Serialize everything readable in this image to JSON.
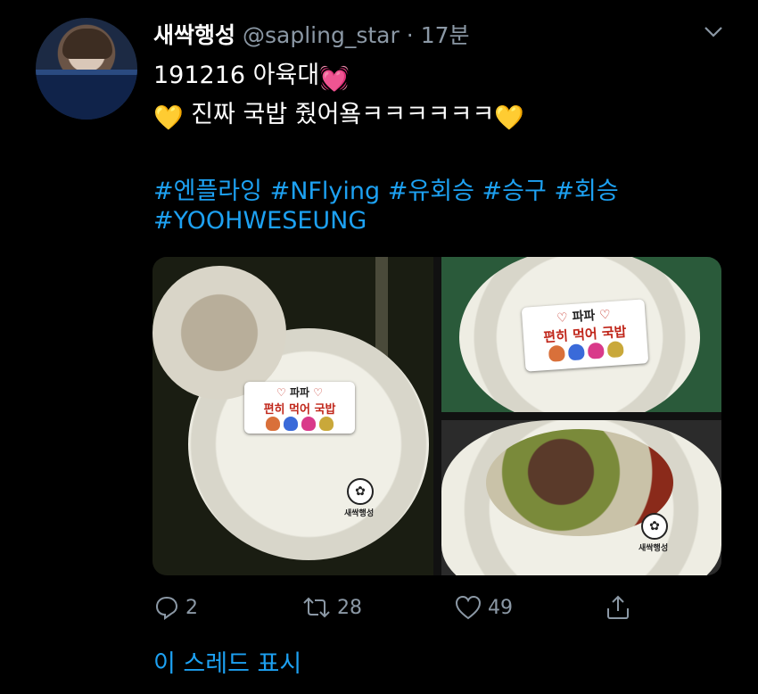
{
  "tweet": {
    "display_name": "새싹행성",
    "handle": "@sapling_star",
    "separator": "·",
    "time": "17분",
    "line1_text": "191216 아육대",
    "line1_emoji": "💓",
    "line2_emoji_left": "💛",
    "line2_text": "진짜 국밥 줬어욬ㅋㅋㅋㅋㅋㅋ",
    "line2_emoji_right": "💛",
    "hashtags_line1": [
      "#엔플라잉",
      "#NFlying",
      "#유회승",
      "#승구",
      "#회승"
    ],
    "hashtags_line2": [
      "#YOOHWESEUNG"
    ]
  },
  "media": {
    "card_heart_left": "♡",
    "card_title": "파파",
    "card_heart_right": "♡",
    "card_subtitle": "편히 먹어 국밥",
    "logo_label": "새싹행성"
  },
  "actions": {
    "reply_count": "2",
    "retweet_count": "28",
    "like_count": "49"
  },
  "show_thread_label": "이 스레드 표시",
  "colors": {
    "background": "#000000",
    "link": "#1da1f2",
    "muted": "#8b98a5",
    "text": "#ffffff"
  }
}
